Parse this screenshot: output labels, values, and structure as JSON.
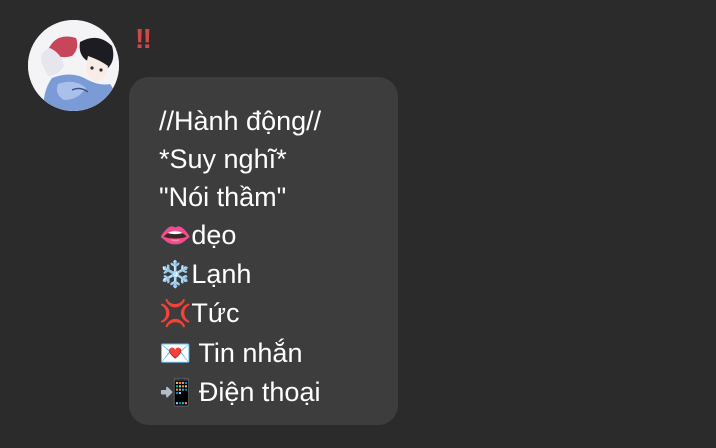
{
  "message": {
    "sender_name": "‼",
    "lines": [
      {
        "icon": "",
        "text": "//Hành động//"
      },
      {
        "icon": "",
        "text": "*Suy nghĩ*"
      },
      {
        "icon": "",
        "text": "\"Nói thầm\""
      },
      {
        "icon": "👄",
        "text": "dẹo"
      },
      {
        "icon": "❄️",
        "text": "Lạnh"
      },
      {
        "icon": "💢",
        "text": "Tức"
      },
      {
        "icon": "💌",
        "text": " Tin nhắn"
      },
      {
        "icon": "📲",
        "text": " Điện thoại"
      }
    ]
  },
  "colors": {
    "background": "#2b2b2b",
    "bubble": "#3d3d3d",
    "sender_name": "#d14848",
    "message_text": "#ffffff"
  }
}
